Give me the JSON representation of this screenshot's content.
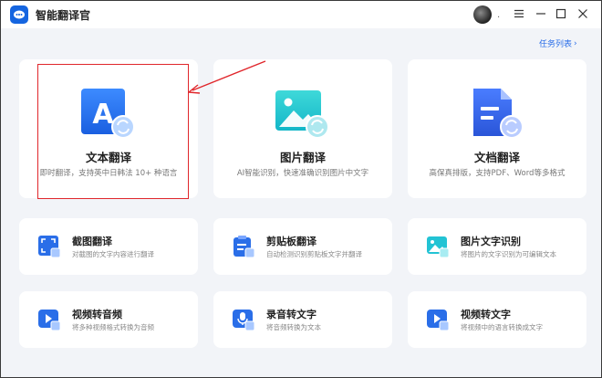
{
  "app": {
    "title": "智能翻译官",
    "avatar_dot": "."
  },
  "header": {
    "task_list": "任务列表",
    "task_list_chevron": "›"
  },
  "big_cards": [
    {
      "title": "文本翻译",
      "desc": "即时翻译，支持英中日韩法 10+ 种语言",
      "icon": "text-a-icon"
    },
    {
      "title": "图片翻译",
      "desc": "AI智能识别，快速准确识别图片中文字",
      "icon": "image-icon"
    },
    {
      "title": "文档翻译",
      "desc": "高保真排版，支持PDF、Word等多格式",
      "icon": "document-icon"
    }
  ],
  "small_cards": [
    {
      "title": "截图翻译",
      "desc": "对截图的文字内容进行翻译",
      "icon": "screenshot-icon"
    },
    {
      "title": "剪贴板翻译",
      "desc": "自动检测识别剪贴板文字并翻译",
      "icon": "clipboard-icon"
    },
    {
      "title": "图片文字识别",
      "desc": "将图片的文字识别为可编辑文本",
      "icon": "image-ocr-icon"
    },
    {
      "title": "视频转音频",
      "desc": "将多种视频格式转换为音频",
      "icon": "video-audio-icon"
    },
    {
      "title": "录音转文字",
      "desc": "将音频转换为文本",
      "icon": "mic-text-icon"
    },
    {
      "title": "视频转文字",
      "desc": "将视频中的语言转换成文字",
      "icon": "video-text-icon"
    }
  ],
  "colors": {
    "accent": "#2a6ee8",
    "highlight": "#e0262b",
    "background": "#f2f4f8"
  }
}
